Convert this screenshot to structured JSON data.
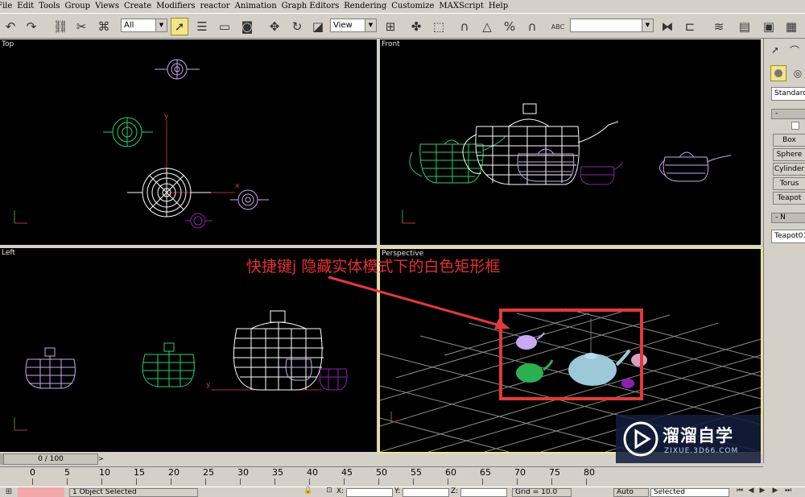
{
  "menu": [
    "File",
    "Edit",
    "Tools",
    "Group",
    "Views",
    "Create",
    "Modifiers",
    "reactor",
    "Animation",
    "Graph Editors",
    "Rendering",
    "Customize",
    "MAXScript",
    "Help"
  ],
  "toolbar": {
    "filter_value": "All",
    "refcoord_value": "View",
    "abc_label": "ABC",
    "named_selection_value": ""
  },
  "viewports": {
    "top": "Top",
    "front": "Front",
    "left": "Left",
    "perspective": "Perspective",
    "axis_x": "x",
    "axis_y": "y"
  },
  "command_panel": {
    "category_value": "Standard",
    "rollout_object_type": "-",
    "primitives": [
      "Box",
      "Sphere",
      "Cylinder",
      "Torus",
      "Teapot"
    ],
    "rollout_name": "- N",
    "name_value": "Teapot01"
  },
  "annotation": "快捷键j 隐藏实体模式下的白色矩形框",
  "time_slider": "0 / 100",
  "ruler_ticks": [
    "0",
    "5",
    "10",
    "15",
    "20",
    "25",
    "30",
    "35",
    "40",
    "45",
    "50",
    "55",
    "60",
    "65",
    "70",
    "75",
    "80"
  ],
  "status": {
    "selection": "1 Object Selected",
    "x_label": "X:",
    "y_label": "Y:",
    "z_label": "Z:",
    "grid": "Grid = 10.0",
    "auto_key": "Auto Key",
    "selected": "Selected"
  },
  "watermark": {
    "title": "溜溜自学",
    "url": "ZIXUE.3D66.COM"
  },
  "colors": {
    "annotation_red": "#e23a3a",
    "viewport_bg": "#000000",
    "active_border": "#f2e58a",
    "lavender": "#c8a8f0",
    "green": "#2ad06a",
    "purple": "#9020b0",
    "teapot_blue": "#9cc8d8"
  }
}
